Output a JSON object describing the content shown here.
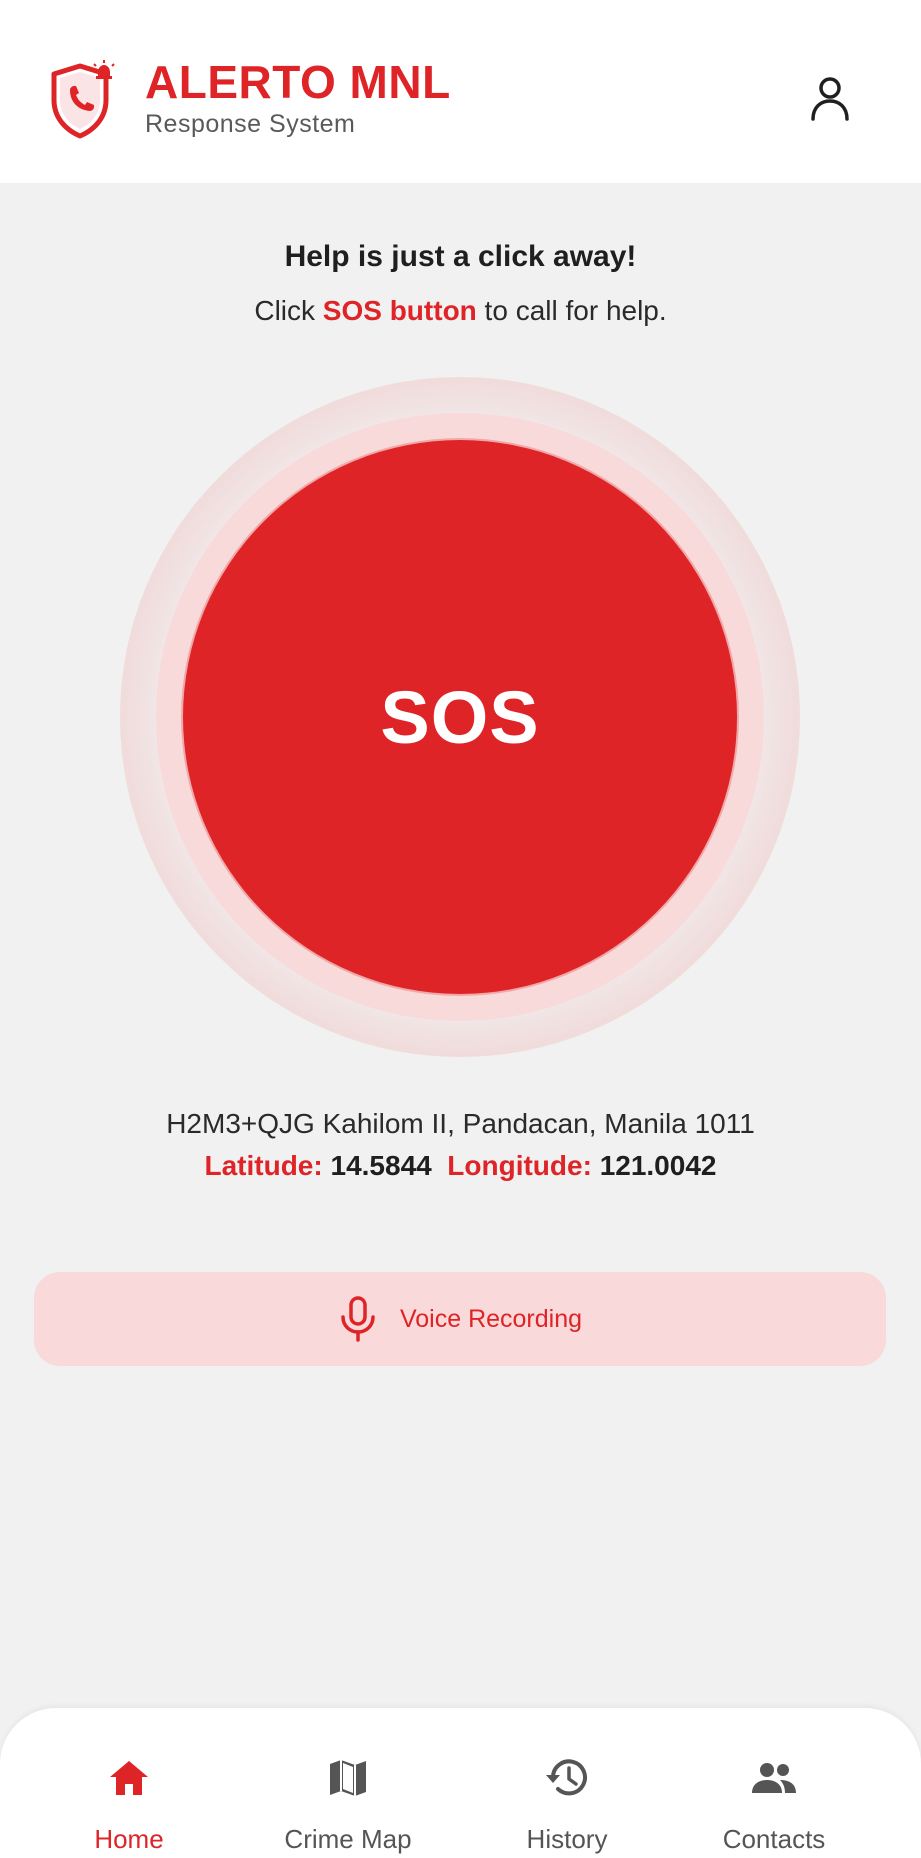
{
  "colors": {
    "accent": "#df2427",
    "accent_light": "#f9d9d9",
    "background": "#f1f1f1",
    "text_dark": "#1f1f1f",
    "text_muted": "#555555"
  },
  "header": {
    "logo_icon": "shield-phone-alarm-icon",
    "title": "ALERTO MNL",
    "subtitle": "Response System",
    "profile_icon": "user-icon"
  },
  "intro": {
    "title": "Help is just a click away!",
    "sub_prefix": "Click ",
    "sub_highlight": "SOS button",
    "sub_suffix": " to call for help."
  },
  "sos": {
    "label": "SOS"
  },
  "location": {
    "address": "H2M3+QJG Kahilom II, Pandacan, Manila 1011",
    "latitude_label": "Latitude:",
    "latitude_value": "14.5844",
    "longitude_label": "Longitude:",
    "longitude_value": "121.0042"
  },
  "voice": {
    "icon": "microphone-icon",
    "label": "Voice Recording"
  },
  "nav": {
    "active": "Home",
    "items": [
      {
        "label": "Home",
        "icon": "home-icon"
      },
      {
        "label": "Crime Map",
        "icon": "map-icon"
      },
      {
        "label": "History",
        "icon": "history-icon"
      },
      {
        "label": "Contacts",
        "icon": "contacts-icon"
      }
    ]
  }
}
